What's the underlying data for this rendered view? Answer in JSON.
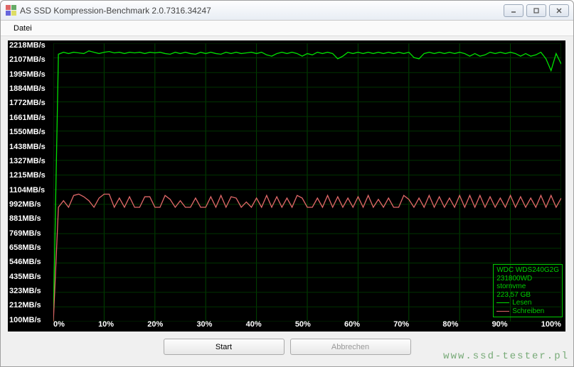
{
  "window": {
    "title": "AS SSD Kompression-Benchmark 2.0.7316.34247"
  },
  "menu": {
    "datei": "Datei"
  },
  "buttons": {
    "start": "Start",
    "abbrechen": "Abbrechen"
  },
  "legend": {
    "device": "WDC WDS240G2G",
    "firmware": "231800WD",
    "driver": "stornvme",
    "capacity": "223,57 GB",
    "read_label": "Lesen",
    "write_label": "Schreiben",
    "read_color": "#00e000",
    "write_color": "#e06868"
  },
  "watermark": "www.ssd-tester.pl",
  "chart_data": {
    "type": "line",
    "xlabel": "",
    "ylabel": "",
    "x_unit": "%",
    "y_unit": "MB/s",
    "xlim": [
      0,
      100
    ],
    "ylim": [
      100,
      2218
    ],
    "categories": [
      0,
      1,
      2,
      3,
      4,
      5,
      6,
      7,
      8,
      9,
      10,
      11,
      12,
      13,
      14,
      15,
      16,
      17,
      18,
      19,
      20,
      21,
      22,
      23,
      24,
      25,
      26,
      27,
      28,
      29,
      30,
      31,
      32,
      33,
      34,
      35,
      36,
      37,
      38,
      39,
      40,
      41,
      42,
      43,
      44,
      45,
      46,
      47,
      48,
      49,
      50,
      51,
      52,
      53,
      54,
      55,
      56,
      57,
      58,
      59,
      60,
      61,
      62,
      63,
      64,
      65,
      66,
      67,
      68,
      69,
      70,
      71,
      72,
      73,
      74,
      75,
      76,
      77,
      78,
      79,
      80,
      81,
      82,
      83,
      84,
      85,
      86,
      87,
      88,
      89,
      90,
      91,
      92,
      93,
      94,
      95,
      96,
      97,
      98,
      99,
      100
    ],
    "x_ticks": [
      "0%",
      "10%",
      "20%",
      "30%",
      "40%",
      "50%",
      "60%",
      "70%",
      "80%",
      "90%",
      "100%"
    ],
    "y_ticks": [
      "2218MB/s",
      "2107MB/s",
      "1995MB/s",
      "1884MB/s",
      "1772MB/s",
      "1661MB/s",
      "1550MB/s",
      "1438MB/s",
      "1327MB/s",
      "1215MB/s",
      "1104MB/s",
      "992MB/s",
      "881MB/s",
      "769MB/s",
      "658MB/s",
      "546MB/s",
      "435MB/s",
      "323MB/s",
      "212MB/s",
      "100MB/s"
    ],
    "series": [
      {
        "name": "Lesen",
        "color": "#00e000",
        "values": [
          100,
          2135,
          2150,
          2140,
          2150,
          2145,
          2140,
          2160,
          2150,
          2140,
          2150,
          2155,
          2145,
          2150,
          2140,
          2150,
          2145,
          2150,
          2140,
          2150,
          2145,
          2150,
          2140,
          2135,
          2150,
          2140,
          2150,
          2140,
          2135,
          2150,
          2140,
          2150,
          2140,
          2135,
          2150,
          2140,
          2150,
          2140,
          2145,
          2150,
          2140,
          2150,
          2130,
          2120,
          2140,
          2150,
          2140,
          2150,
          2140,
          2120,
          2140,
          2130,
          2150,
          2140,
          2150,
          2140,
          2100,
          2120,
          2150,
          2140,
          2150,
          2140,
          2150,
          2140,
          2150,
          2140,
          2150,
          2140,
          2150,
          2140,
          2150,
          2110,
          2100,
          2140,
          2150,
          2140,
          2150,
          2140,
          2150,
          2140,
          2150,
          2140,
          2120,
          2140,
          2120,
          2130,
          2150,
          2140,
          2150,
          2140,
          2150,
          2140,
          2120,
          2140,
          2120,
          2130,
          2150,
          2100,
          2010,
          2140,
          2060
        ]
      },
      {
        "name": "Schreiben",
        "color": "#e06868",
        "values": [
          100,
          970,
          1020,
          970,
          1060,
          1070,
          1050,
          1020,
          970,
          1040,
          1070,
          1070,
          970,
          1040,
          970,
          1050,
          970,
          970,
          1050,
          1050,
          970,
          970,
          1060,
          1030,
          970,
          1020,
          970,
          970,
          1040,
          970,
          970,
          1050,
          970,
          1060,
          970,
          1050,
          1040,
          970,
          1010,
          970,
          1040,
          970,
          1060,
          970,
          1050,
          970,
          1040,
          970,
          1060,
          1040,
          970,
          970,
          1040,
          970,
          1060,
          970,
          1050,
          970,
          1040,
          970,
          1050,
          970,
          1060,
          970,
          1030,
          970,
          1040,
          970,
          970,
          1060,
          1030,
          970,
          1040,
          970,
          1060,
          970,
          1050,
          970,
          1040,
          970,
          1060,
          970,
          1060,
          970,
          1060,
          970,
          1050,
          970,
          1040,
          970,
          1060,
          970,
          1050,
          970,
          1040,
          970,
          1060,
          970,
          1060,
          970,
          1040
        ]
      }
    ]
  }
}
